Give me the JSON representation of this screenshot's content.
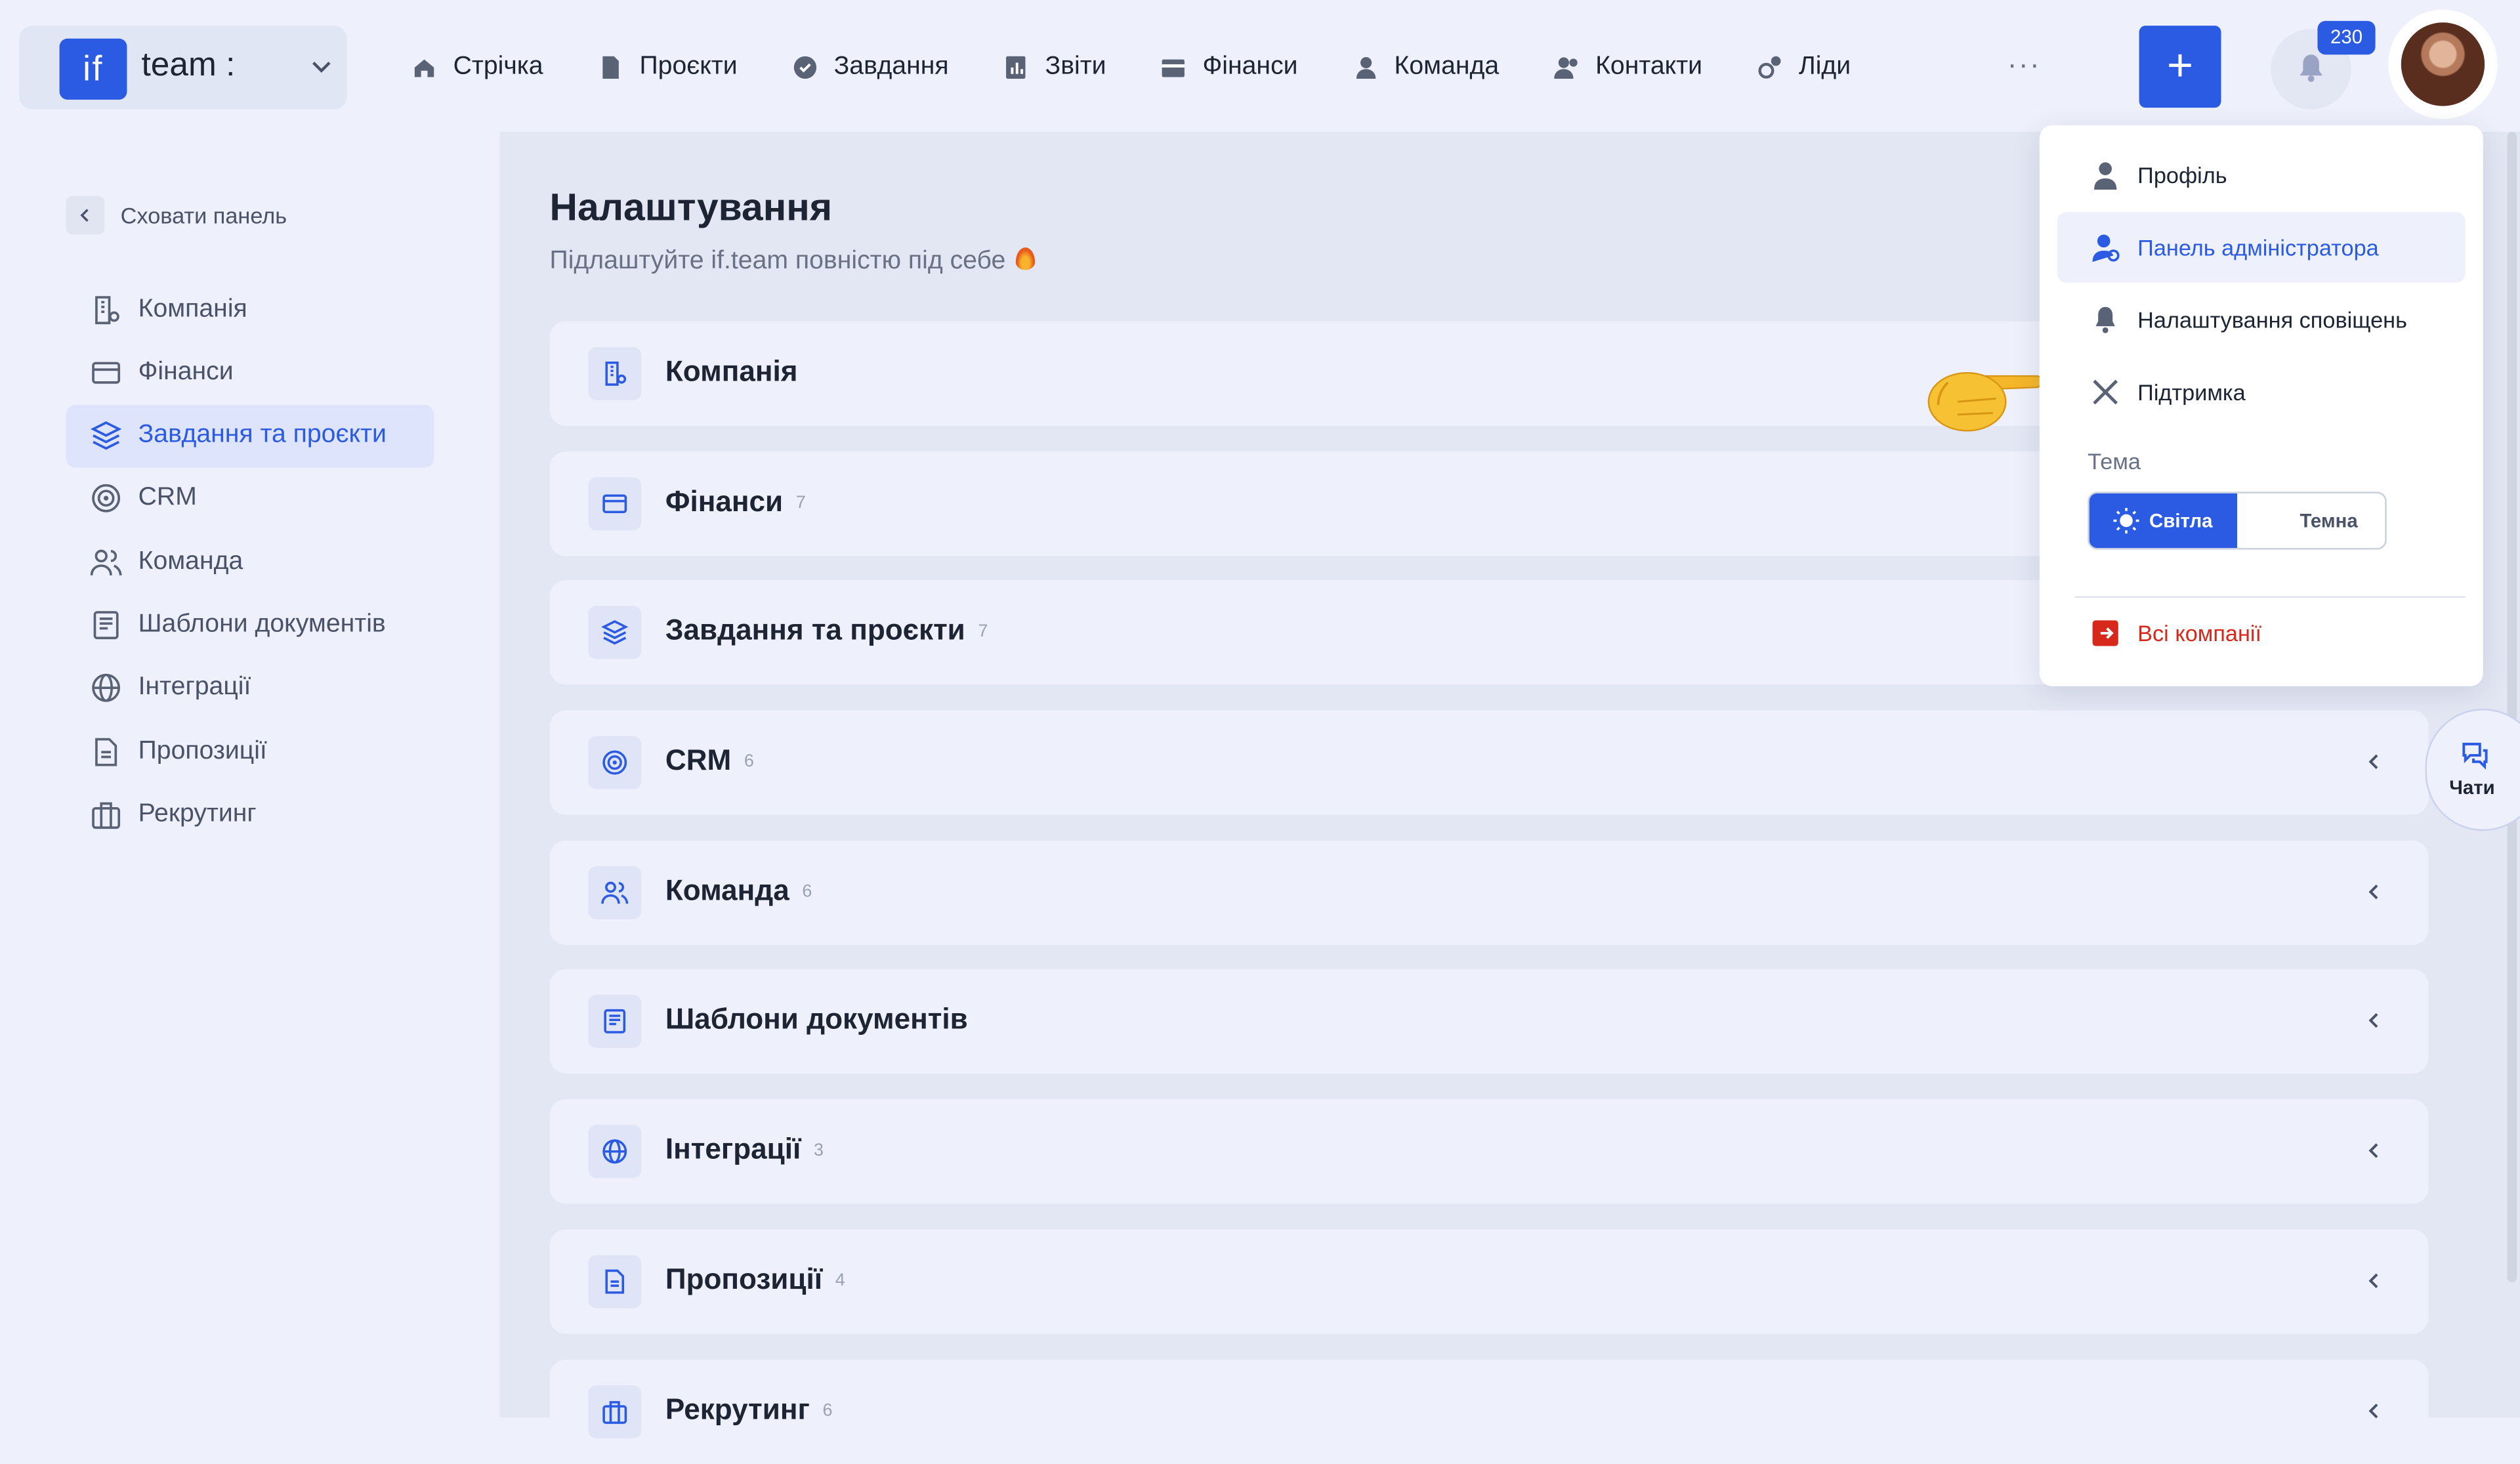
{
  "brand": {
    "logo": "if",
    "name": "team :"
  },
  "nav": [
    {
      "label": "Стрічка",
      "icon": "home-icon"
    },
    {
      "label": "Проєкти",
      "icon": "document-icon"
    },
    {
      "label": "Завдання",
      "icon": "check-circle-icon"
    },
    {
      "label": "Звіти",
      "icon": "report-icon"
    },
    {
      "label": "Фінанси",
      "icon": "wallet-icon"
    },
    {
      "label": "Команда",
      "icon": "person-icon"
    },
    {
      "label": "Контакти",
      "icon": "contacts-icon"
    },
    {
      "label": "Ліди",
      "icon": "leads-icon"
    }
  ],
  "nav_more": "···",
  "plus_label": "+",
  "notifications": {
    "count": "230"
  },
  "sidebar": {
    "hide_label": "Сховати панель",
    "items": [
      {
        "label": "Компанія",
        "icon": "company-settings-icon"
      },
      {
        "label": "Фінанси",
        "icon": "card-icon"
      },
      {
        "label": "Завдання та проєкти",
        "icon": "layers-icon",
        "active": true
      },
      {
        "label": "CRM",
        "icon": "target-icon"
      },
      {
        "label": "Команда",
        "icon": "users-icon"
      },
      {
        "label": "Шаблони документів",
        "icon": "template-icon"
      },
      {
        "label": "Інтеграції",
        "icon": "globe-icon"
      },
      {
        "label": "Пропозиції",
        "icon": "proposal-icon"
      },
      {
        "label": "Рекрутинг",
        "icon": "briefcase-icon"
      }
    ]
  },
  "main": {
    "title": "Налаштування",
    "subtitle": "Підлаштуйте if.team повністю під себе",
    "sections": [
      {
        "label": "Компанія",
        "count": ""
      },
      {
        "label": "Фінанси",
        "count": "7"
      },
      {
        "label": "Завдання та проєкти",
        "count": "7"
      },
      {
        "label": "CRM",
        "count": "6"
      },
      {
        "label": "Команда",
        "count": "6"
      },
      {
        "label": "Шаблони документів",
        "count": ""
      },
      {
        "label": "Інтеграції",
        "count": "3"
      },
      {
        "label": "Пропозиції",
        "count": "4"
      },
      {
        "label": "Рекрутинг",
        "count": "6"
      }
    ]
  },
  "dropdown": {
    "items": [
      {
        "label": "Профіль"
      },
      {
        "label": "Панель адміністратора"
      },
      {
        "label": "Налаштування сповіщень"
      },
      {
        "label": "Підтримка"
      }
    ],
    "theme_label": "Тема",
    "theme_light": "Світла",
    "theme_dark": "Темна",
    "logout": "Всі компанії"
  },
  "chats_label": "Чати",
  "colors": {
    "accent": "#2b5be3",
    "danger": "#d7281c",
    "background": "#eef1fb"
  }
}
